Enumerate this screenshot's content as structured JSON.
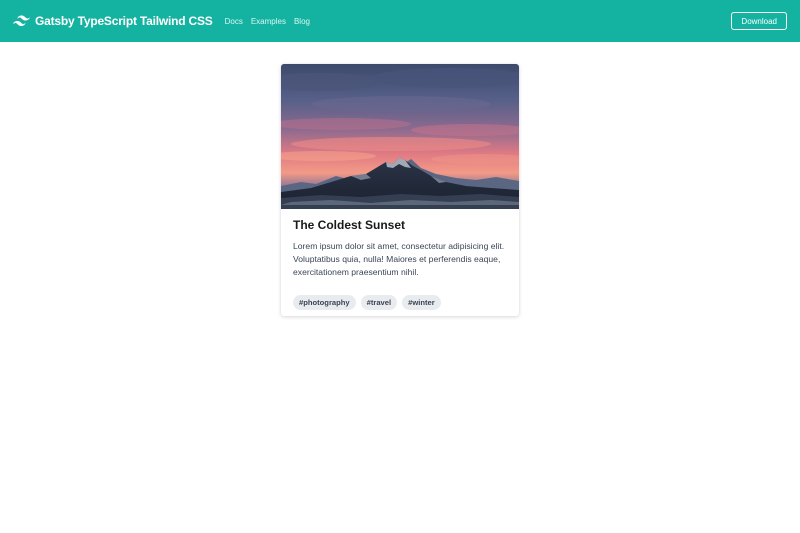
{
  "navbar": {
    "brand_title": "Gatsby TypeScript Tailwind CSS",
    "brand_icon": "tailwind-logo-icon",
    "links": [
      {
        "label": "Docs"
      },
      {
        "label": "Examples"
      },
      {
        "label": "Blog"
      }
    ],
    "download_label": "Download"
  },
  "card": {
    "image_subject": "mountain-sunset-photo",
    "title": "The Coldest Sunset",
    "text": "Lorem ipsum dolor sit amet, consectetur adipisicing elit. Voluptatibus quia, nulla! Maiores et perferendis eaque, exercitationem praesentium nihil.",
    "tags": [
      {
        "label": "#photography"
      },
      {
        "label": "#travel"
      },
      {
        "label": "#winter"
      }
    ]
  },
  "colors": {
    "navbar_bg": "#14b3a1",
    "tag_bg": "#e9ecef",
    "page_bg": "#ffffff"
  }
}
